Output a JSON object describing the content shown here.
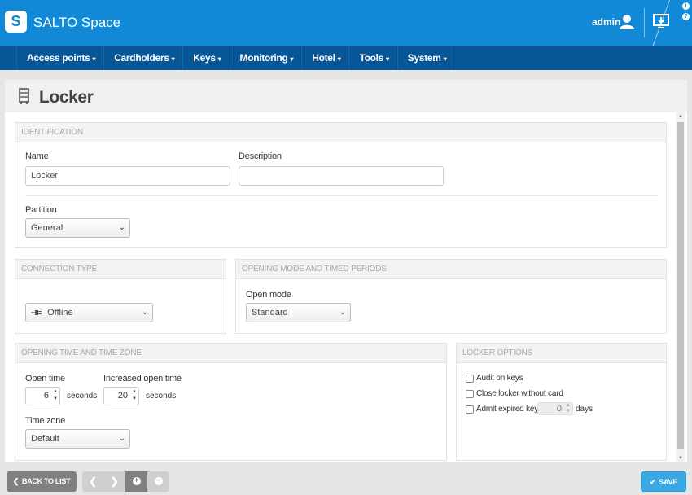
{
  "header": {
    "logo_letter": "S",
    "brand": "SALTO Space",
    "user": "admin",
    "info_glyph": "i",
    "help_glyph": "?"
  },
  "nav": {
    "caret": "▾",
    "items": [
      "Access points",
      "Cardholders",
      "Keys",
      "Monitoring",
      "Hotel",
      "Tools",
      "System"
    ]
  },
  "page": {
    "title": "Locker"
  },
  "identification": {
    "heading": "IDENTIFICATION",
    "name_label": "Name",
    "name_value": "Locker",
    "description_label": "Description",
    "description_value": "",
    "partition_label": "Partition",
    "partition_value": "General"
  },
  "connection": {
    "heading": "CONNECTION TYPE",
    "icon": "plug-icon",
    "value": "Offline"
  },
  "opening_mode": {
    "heading": "OPENING MODE AND TIMED PERIODS",
    "open_mode_label": "Open mode",
    "open_mode_value": "Standard"
  },
  "opening_time": {
    "heading": "OPENING TIME AND TIME ZONE",
    "open_time_label": "Open time",
    "open_time_value": "6",
    "increased_label": "Increased open time",
    "increased_value": "20",
    "unit": "seconds",
    "timezone_label": "Time zone",
    "timezone_value": "Default"
  },
  "locker_options": {
    "heading": "LOCKER OPTIONS",
    "audit_label": "Audit on keys",
    "close_label": "Close locker without card",
    "admit_label": "Admit expired keys",
    "admit_value": "0",
    "admit_unit": "days"
  },
  "footer": {
    "back_label": "BACK TO LIST",
    "back_glyph": "❮",
    "prev_glyph": "❮",
    "next_glyph": "❯",
    "add_glyph": "+",
    "remove_glyph": "−",
    "save_label": "SAVE",
    "save_glyph": "✔"
  },
  "colors": {
    "header_blue": "#1189d6",
    "nav_blue": "#075697",
    "save_blue": "#39a9e6",
    "button_gray": "#808080"
  }
}
